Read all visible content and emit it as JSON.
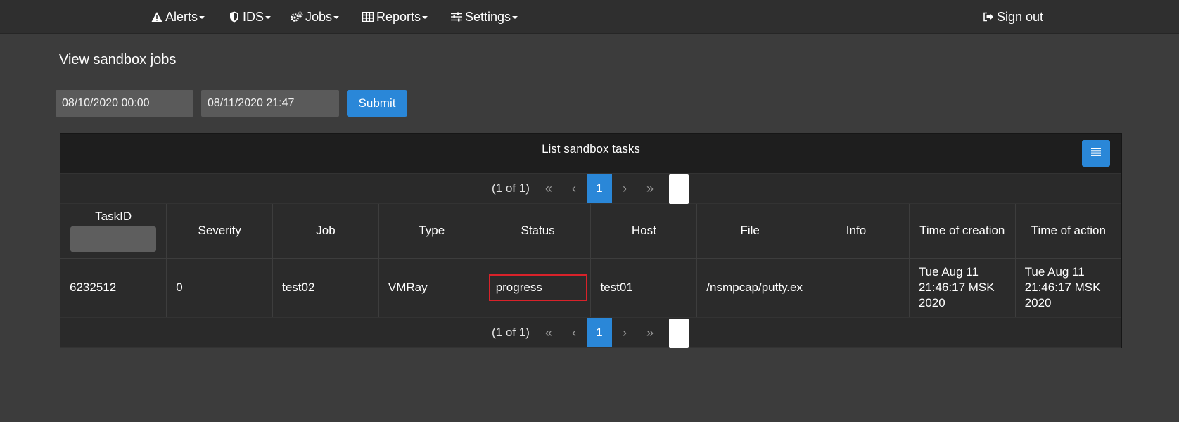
{
  "nav": {
    "items": [
      {
        "label": "Alerts",
        "icon": "warning-icon"
      },
      {
        "label": "IDS",
        "icon": "shield-icon"
      },
      {
        "label": "Jobs",
        "icon": "gears-icon"
      },
      {
        "label": "Reports",
        "icon": "table-icon"
      },
      {
        "label": "Settings",
        "icon": "sliders-icon"
      }
    ],
    "sign_out": {
      "label": "Sign out",
      "icon": "sign-out-icon"
    }
  },
  "page": {
    "title": "View sandbox jobs"
  },
  "filter": {
    "date_from": "08/10/2020 00:00",
    "date_to": "08/11/2020 21:47",
    "submit_label": "Submit"
  },
  "panel": {
    "title": "List sandbox tasks",
    "toggler_icon": "list-icon"
  },
  "paginator": {
    "report": "(1 of 1)",
    "first": "«",
    "prev": "‹",
    "page": "1",
    "next": "›",
    "last": "»"
  },
  "table": {
    "columns": [
      "TaskID",
      "Severity",
      "Job",
      "Type",
      "Status",
      "Host",
      "File",
      "Info",
      "Time of creation",
      "Time of action"
    ],
    "rows": [
      {
        "task_id": "6232512",
        "severity": "0",
        "job": "test02",
        "type": "VMRay",
        "status": "progress",
        "host": "test01",
        "file": "/nsmpcap/putty.ex",
        "info": "",
        "time_creation": "Tue Aug 11 21:46:17 MSK 2020",
        "time_action": "Tue Aug 11 21:46:17 MSK 2020"
      }
    ]
  },
  "colors": {
    "accent": "#2a87d8",
    "highlight": "#d9222a",
    "background": "#3c3c3c"
  }
}
